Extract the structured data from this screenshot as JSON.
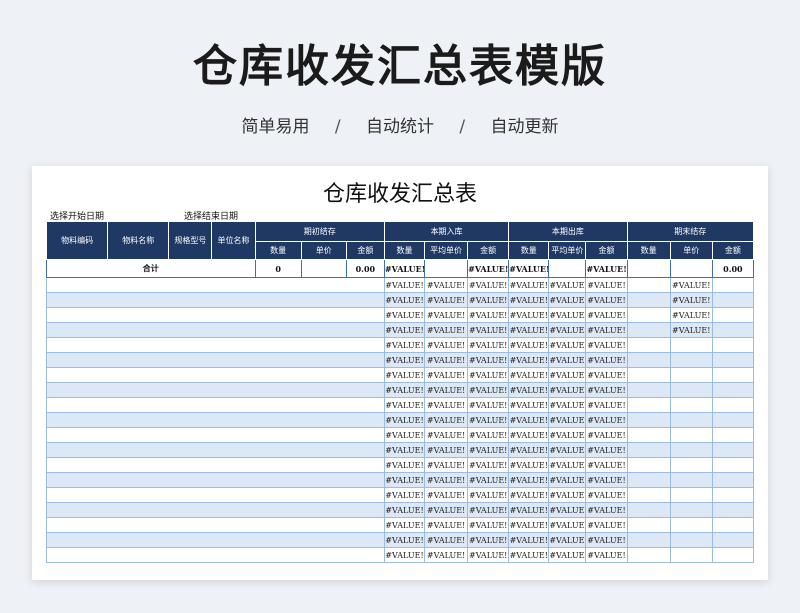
{
  "hero": {
    "title": "仓库收发汇总表模版",
    "tags": [
      "简单易用",
      "自动统计",
      "自动更新"
    ],
    "separator": "/"
  },
  "sheet": {
    "title": "仓库收发汇总表",
    "start_date_label": "选择开始日期",
    "end_date_label": "选择结束日期",
    "headers": {
      "material_code": "物料编码",
      "material_name": "物料名称",
      "spec_model": "规格型号",
      "unit_name": "单位名称",
      "groups": [
        "期初结存",
        "本期入库",
        "本期出库",
        "期末结存"
      ],
      "opening_sub": [
        "数量",
        "单价",
        "金额"
      ],
      "in_sub": [
        "数量",
        "平均单价",
        "金额"
      ],
      "out_sub": [
        "数量",
        "平均单价",
        "金额"
      ],
      "closing_sub": [
        "数量",
        "单价",
        "金额"
      ]
    },
    "total": {
      "label": "合计",
      "opening_qty": "0",
      "opening_price": "",
      "opening_amount": "0.00",
      "in_qty": "#VALUE!",
      "in_avg": "",
      "in_amount": "#VALUE!",
      "out_qty": "#VALUE!",
      "out_avg": "",
      "out_amount": "#VALUE!",
      "closing_qty": "",
      "closing_price": "",
      "closing_amount": "0.00"
    },
    "error_value": "#VALUE!",
    "rows": [
      {
        "closing_price": "#VALUE!"
      },
      {
        "closing_price": "#VALUE!"
      },
      {
        "closing_price": "#VALUE!"
      },
      {
        "closing_price": "#VALUE!"
      },
      {
        "closing_price": ""
      },
      {
        "closing_price": ""
      },
      {
        "closing_price": ""
      },
      {
        "closing_price": ""
      },
      {
        "closing_price": ""
      },
      {
        "closing_price": ""
      },
      {
        "closing_price": ""
      },
      {
        "closing_price": ""
      },
      {
        "closing_price": ""
      },
      {
        "closing_price": ""
      },
      {
        "closing_price": ""
      },
      {
        "closing_price": ""
      },
      {
        "closing_price": ""
      },
      {
        "closing_price": ""
      },
      {
        "closing_price": ""
      }
    ]
  }
}
